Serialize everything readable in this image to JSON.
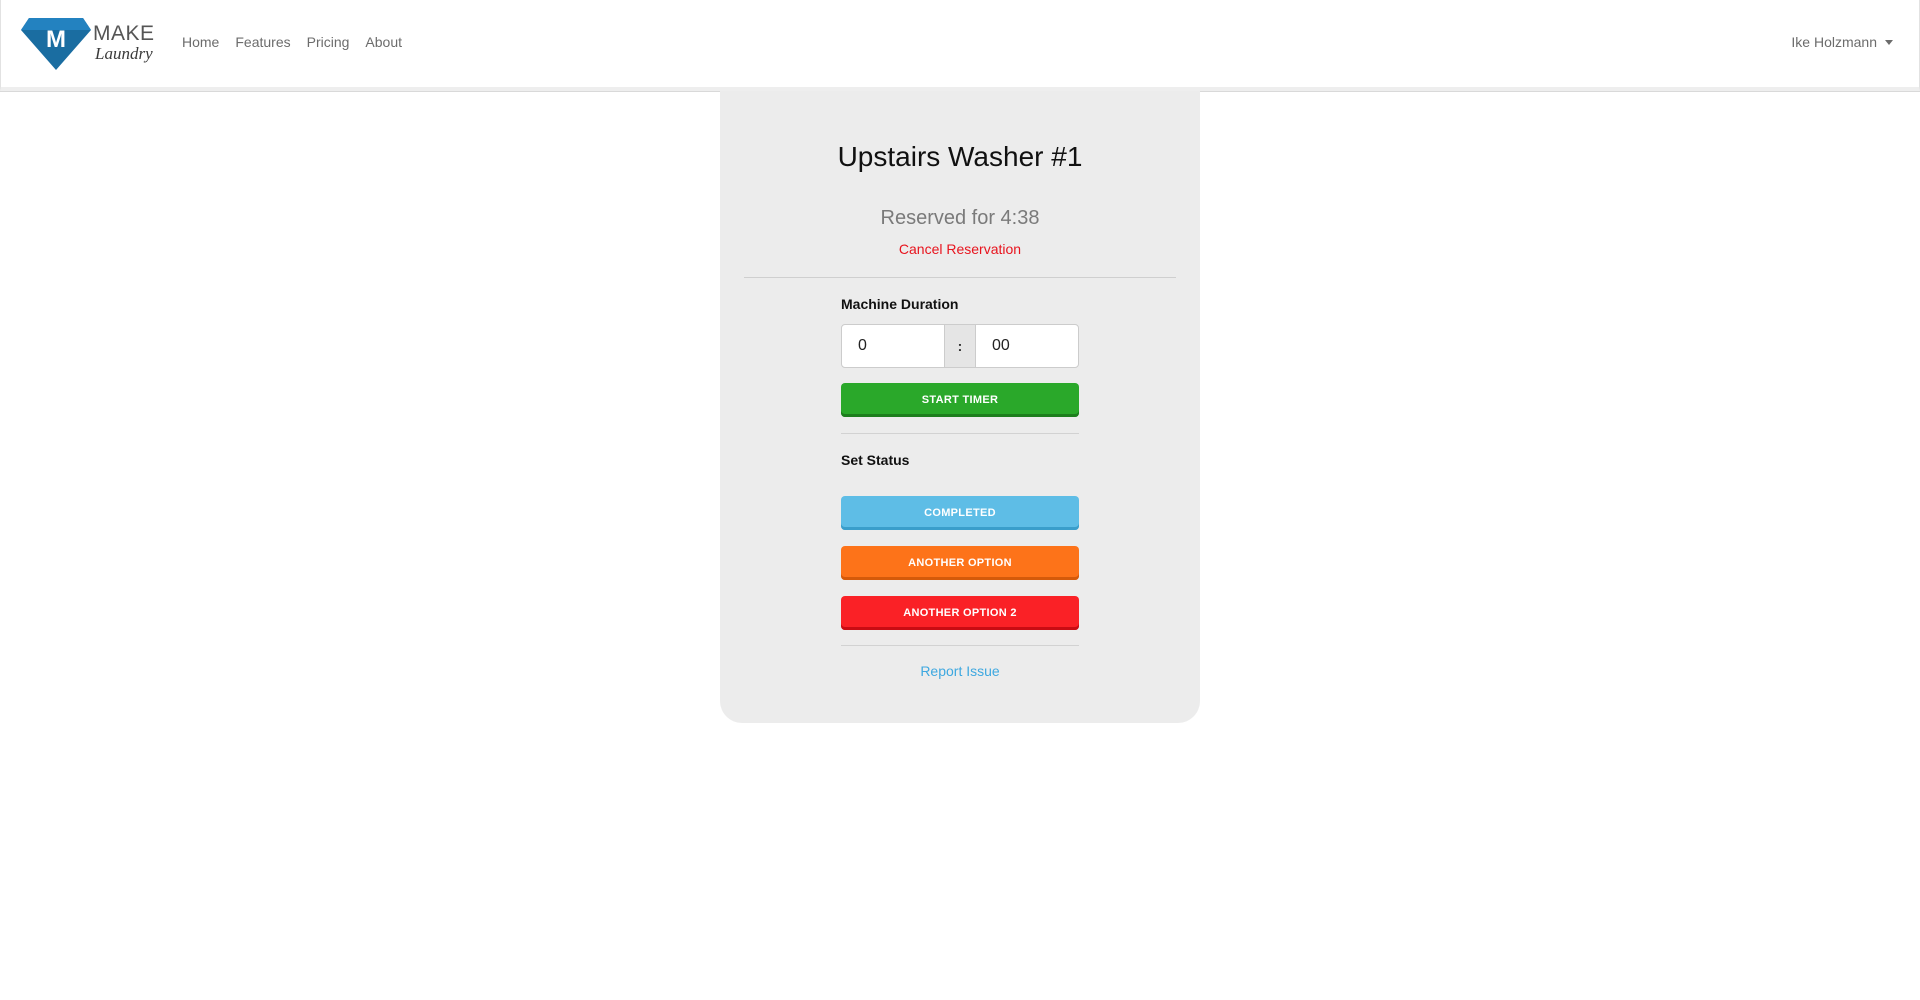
{
  "brand": {
    "logo_letter": "M",
    "name": "MAKE",
    "subtitle": "Laundry",
    "primary_color": "#1a6da1"
  },
  "nav": {
    "links": [
      "Home",
      "Features",
      "Pricing",
      "About"
    ]
  },
  "user": {
    "name": "Ike Holzmann",
    "icon": "chevron-down-icon"
  },
  "machine": {
    "title": "Upstairs Washer #1",
    "reserved_text": "Reserved for 4:38",
    "cancel_label": "Cancel Reservation"
  },
  "duration": {
    "label": "Machine Duration",
    "hours_value": "0",
    "separator": ":",
    "minutes_value": "00"
  },
  "actions": {
    "start_timer": "START TIMER"
  },
  "status": {
    "label": "Set Status",
    "buttons": [
      {
        "label": "COMPLETED",
        "color": "#5ebde6"
      },
      {
        "label": "ANOTHER OPTION",
        "color": "#fd7319"
      },
      {
        "label": "ANOTHER OPTION 2",
        "color": "#fa2126"
      }
    ]
  },
  "report": {
    "label": "Report Issue"
  },
  "colors": {
    "start_green": "#2aa82a",
    "cancel_red": "#e8141e",
    "link_blue": "#3ea8e0",
    "card_bg": "#ececec"
  }
}
